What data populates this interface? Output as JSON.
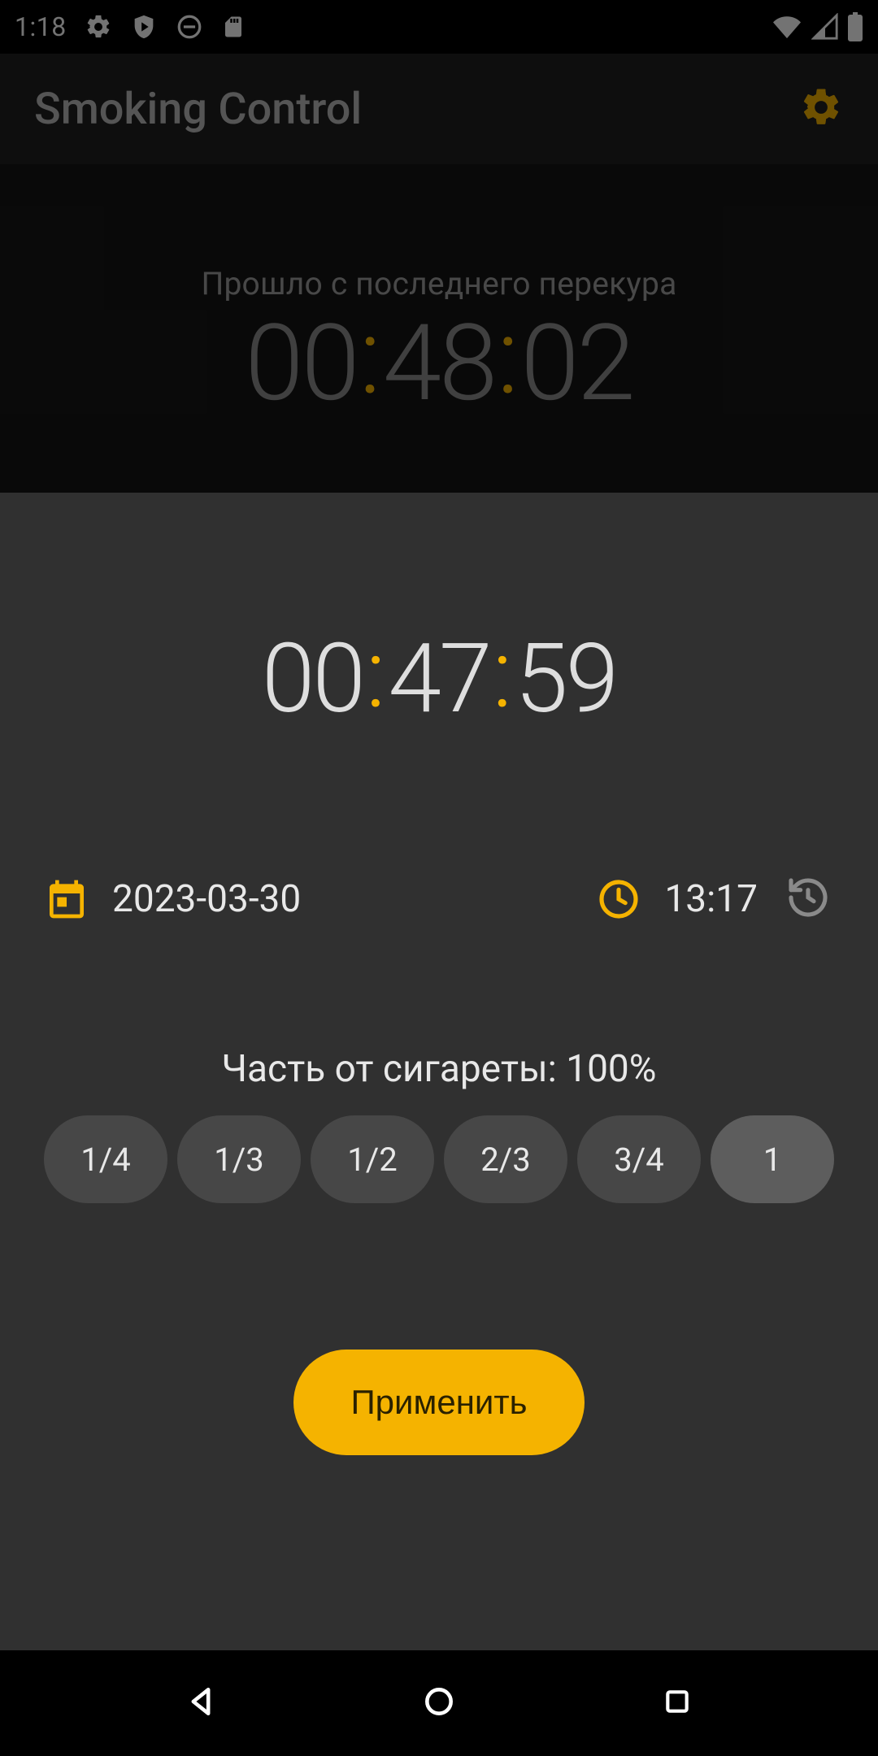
{
  "status_bar": {
    "time": "1:18"
  },
  "app_bar": {
    "title": "Smoking Control"
  },
  "top_panel": {
    "label": "Прошло с последнего перекура",
    "hours": "00",
    "minutes": "48",
    "seconds": "02"
  },
  "dialog": {
    "countdown": {
      "hours": "00",
      "minutes": "47",
      "seconds": "59"
    },
    "date": "2023-03-30",
    "time": "13:17",
    "fraction_label": "Часть от сигареты: 100%",
    "segments": [
      {
        "label": "1/4",
        "selected": false
      },
      {
        "label": "1/3",
        "selected": false
      },
      {
        "label": "1/2",
        "selected": false
      },
      {
        "label": "2/3",
        "selected": false
      },
      {
        "label": "3/4",
        "selected": false
      },
      {
        "label": "1",
        "selected": true
      }
    ],
    "apply_label": "Применить"
  },
  "colors": {
    "accent": "#f5b300"
  }
}
